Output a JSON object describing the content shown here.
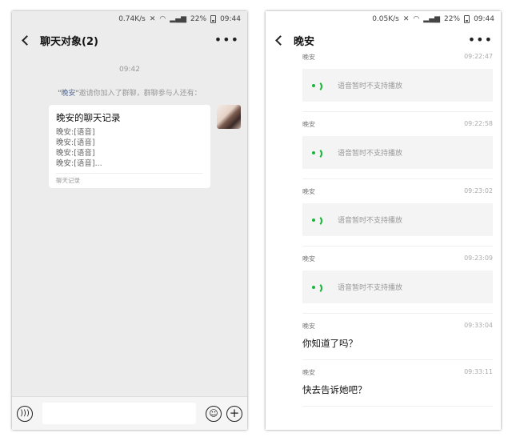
{
  "left": {
    "status": {
      "speed": "0.74K/s",
      "battery": "22%",
      "time": "09:44"
    },
    "header": {
      "title": "聊天对象(2)",
      "more": "•••"
    },
    "chat": {
      "time": "09:42",
      "system": {
        "name": "\"晚安\"",
        "text": "邀请你加入了群聊，群聊参与人还有："
      },
      "card": {
        "title": "晚安的聊天记录",
        "lines": [
          "晚安:[语音]",
          "晚安:[语音]",
          "晚安:[语音]",
          "晚安:[语音]..."
        ],
        "footer": "聊天记录"
      }
    },
    "input": {
      "placeholder": ""
    }
  },
  "right": {
    "status": {
      "speed": "0.05K/s",
      "battery": "22%",
      "time": "09:44"
    },
    "header": {
      "title": "晚安",
      "more": "•••"
    },
    "records": [
      {
        "name": "晚安",
        "time": "09:22:47",
        "voice": "语音暂时不支持播放"
      },
      {
        "name": "晚安",
        "time": "09:22:58",
        "voice": "语音暂时不支持播放"
      },
      {
        "name": "晚安",
        "time": "09:23:02",
        "voice": "语音暂时不支持播放"
      },
      {
        "name": "晚安",
        "time": "09:23:09",
        "voice": "语音暂时不支持播放"
      },
      {
        "name": "晚安",
        "time": "09:33:04",
        "text": "你知道了吗？"
      },
      {
        "name": "晚安",
        "time": "09:33:11",
        "text": "快去告诉她吧？"
      }
    ]
  },
  "colors": {
    "accent_green": "#17b83a",
    "name_link": "#576b95"
  }
}
